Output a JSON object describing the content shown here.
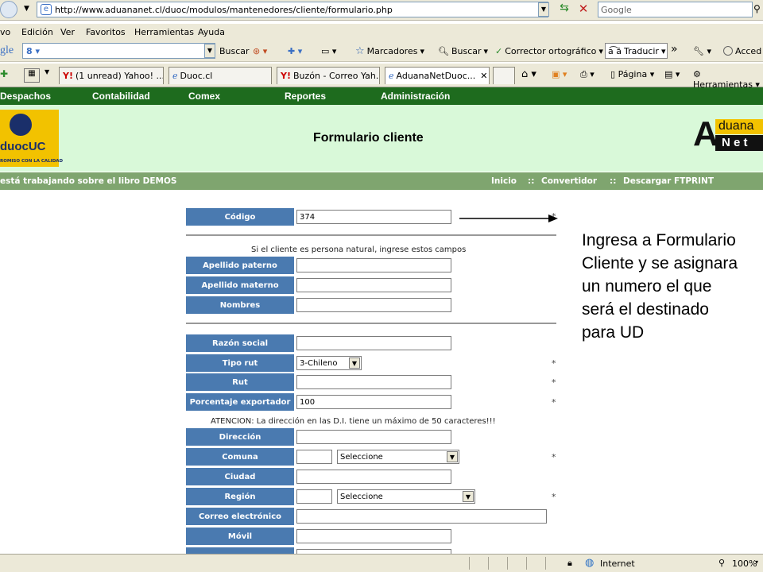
{
  "browser": {
    "url": "http://www.aduananet.cl/duoc/modulos/mantenedores/cliente/formulario.php",
    "search_placeholder": "Google"
  },
  "menubar": [
    "vo",
    "Edición",
    "Ver",
    "Favoritos",
    "Herramientas",
    "Ayuda"
  ],
  "google_toolbar": {
    "logo": "gle",
    "buscar": "Buscar",
    "marcadores": "Marcadores",
    "buscar2": "Buscar",
    "corrector": "Corrector ortográfico",
    "traducir": "Traducir",
    "more": "»",
    "acced": "Acced"
  },
  "tabs": [
    {
      "label": "(1 unread) Yahoo! ..."
    },
    {
      "label": "Duoc.cl"
    },
    {
      "label": "Buzón - Correo Yah..."
    },
    {
      "label": "AduanaNetDuoc..."
    }
  ],
  "command_bar": {
    "pagina": "Página",
    "herramientas": "Herramientas"
  },
  "site_menu": [
    "Despachos",
    "Contabilidad",
    "Comex",
    "Reportes",
    "Administración"
  ],
  "banner": {
    "logo_left_text": "duocUC",
    "logo_left_tagline": "ROMISO CON LA CALIDAD",
    "title": "Formulario cliente",
    "logo_right_top": "duana",
    "logo_right_bottom": "N e t",
    "logo_right_letter": "A"
  },
  "infobar": {
    "left": "está trabajando sobre el libro DEMOS",
    "links": [
      "Inicio",
      "::",
      "Convertidor",
      "::",
      "Descargar FTPRINT"
    ]
  },
  "form": {
    "codigo_label": "Código",
    "codigo_value": "374",
    "natural_note": "Si el cliente es persona natural, ingrese estos campos",
    "apellido_paterno": "Apellido paterno",
    "apellido_materno": "Apellido materno",
    "nombres": "Nombres",
    "razon_social": "Razón social",
    "tipo_rut": "Tipo rut",
    "tipo_rut_value": "3-Chileno",
    "rut": "Rut",
    "porcentaje": "Porcentaje exportador",
    "porcentaje_value": "100",
    "atencion": "ATENCION: La dirección en las D.I. tiene un máximo de 50 caracteres!!!",
    "direccion": "Dirección",
    "comuna": "Comuna",
    "comuna_select": "Seleccione",
    "ciudad": "Ciudad",
    "region": "Región",
    "region_select": "Seleccione",
    "correo": "Correo electrónico",
    "movil": "Móvil",
    "required_mark": "*"
  },
  "annotation": "Ingresa a Formulario Cliente y se asignara un numero el que será el destinado para UD",
  "status": {
    "zone": "Internet",
    "zoom": "100%"
  }
}
